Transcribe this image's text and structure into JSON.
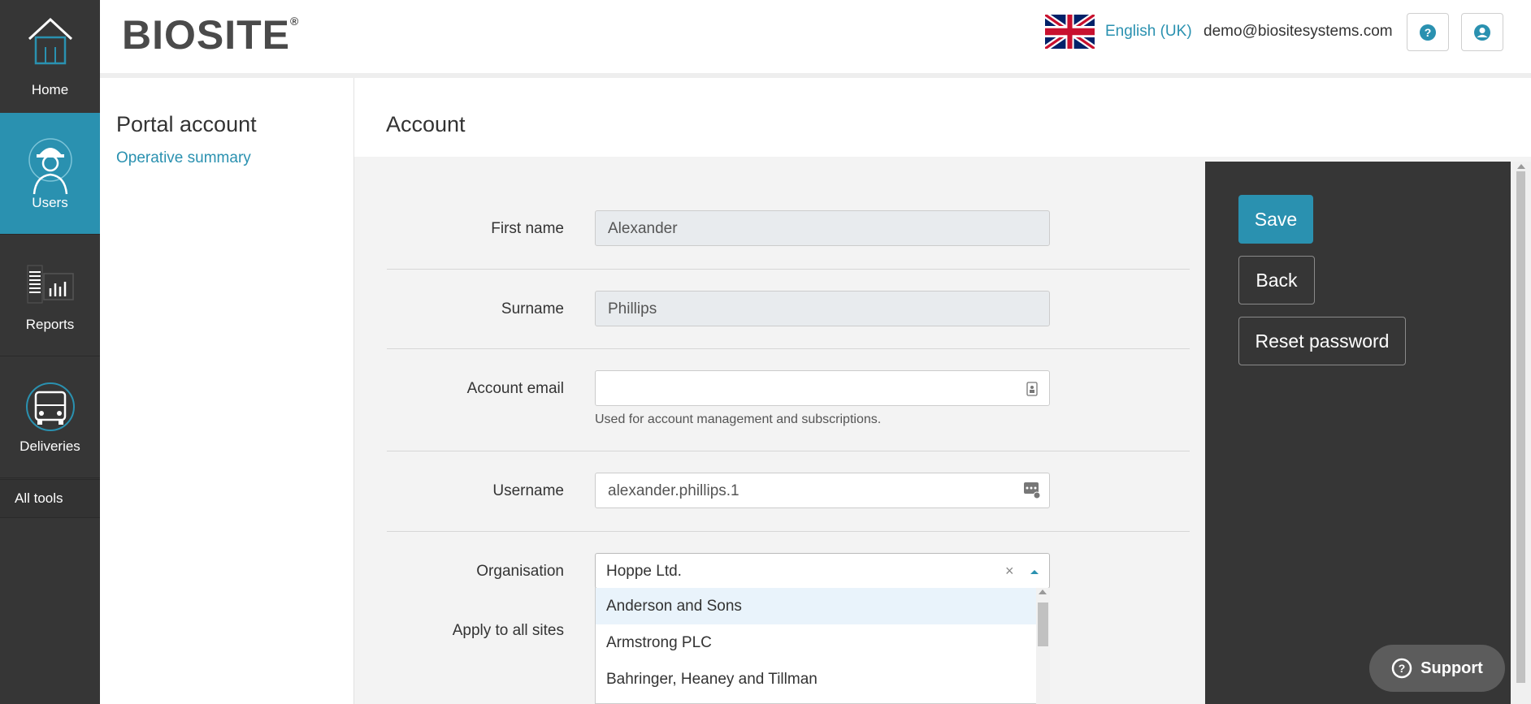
{
  "brand": {
    "logo_text": "BIOSITE",
    "registered_mark": "®"
  },
  "header": {
    "language": "English (UK)",
    "user_email": "demo@biositesystems.com",
    "help_icon": "question-circle-icon",
    "account_icon": "user-circle-icon"
  },
  "nav": {
    "items": [
      {
        "label": "Home",
        "icon": "house-icon"
      },
      {
        "label": "Users",
        "icon": "worker-helmet-icon",
        "active": true
      },
      {
        "label": "Reports",
        "icon": "report-chart-icon"
      },
      {
        "label": "Deliveries",
        "icon": "truck-icon"
      }
    ],
    "all_tools": "All tools"
  },
  "subnav": {
    "title": "Portal account",
    "link": "Operative summary"
  },
  "page": {
    "title": "Account"
  },
  "form": {
    "first_name": {
      "label": "First name",
      "value": "Alexander"
    },
    "surname": {
      "label": "Surname",
      "value": "Phillips"
    },
    "account_email": {
      "label": "Account email",
      "value": "",
      "help": "Used for account management and subscriptions."
    },
    "username": {
      "label": "Username",
      "value": "alexander.phillips.1"
    },
    "organisation": {
      "label": "Organisation",
      "value": "Hoppe Ltd.",
      "clear": "×"
    },
    "apply_all_sites": {
      "label": "Apply to all sites"
    }
  },
  "dropdown": {
    "options": [
      "Anderson and Sons",
      "Armstrong PLC",
      "Bahringer, Heaney and Tillman"
    ],
    "highlighted": 0
  },
  "actions": {
    "save": "Save",
    "back": "Back",
    "reset_password": "Reset password"
  },
  "support": {
    "label": "Support"
  },
  "colors": {
    "accent": "#2a91b0",
    "nav_bg": "#363636",
    "panel_bg": "#363636"
  }
}
